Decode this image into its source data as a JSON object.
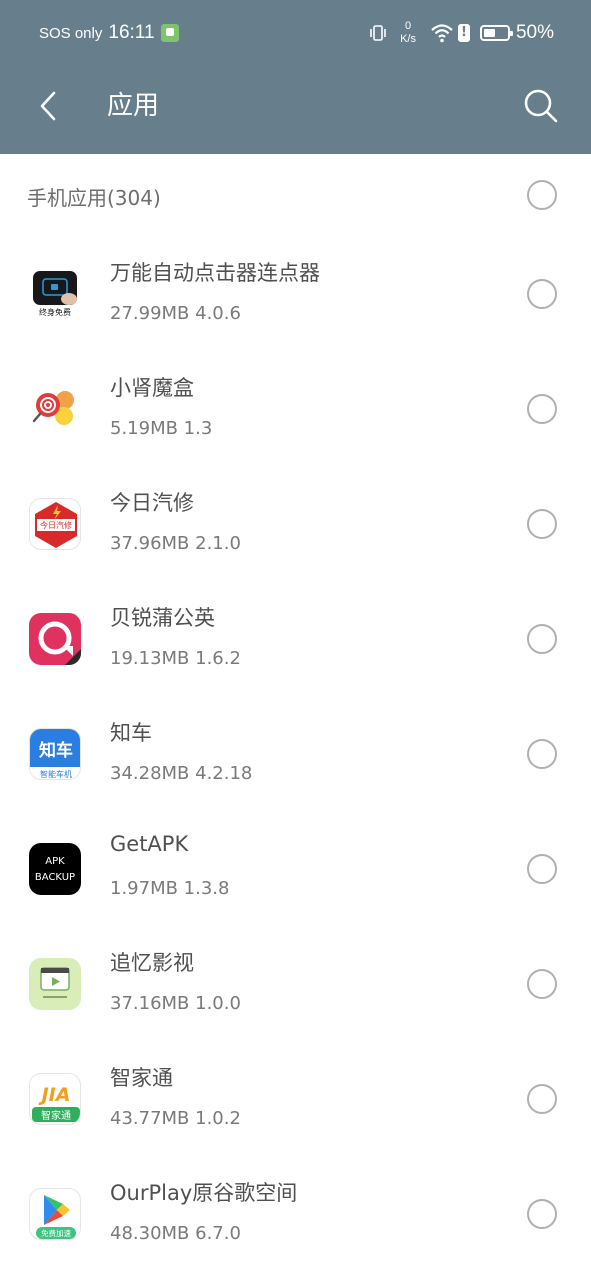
{
  "status_bar": {
    "carrier": "SOS only",
    "time": "16:11",
    "net_speed_value": "0",
    "net_speed_unit": "K/s",
    "battery_percent_label": "50%",
    "battery_level": 0.5
  },
  "app_bar": {
    "title": "应用",
    "back_icon": "chevron-left-icon",
    "search_icon": "search-icon"
  },
  "section": {
    "label": "手机应用(304)"
  },
  "apps": [
    {
      "name": "万能自动点击器连点器",
      "meta": "27.99MB 4.0.6",
      "icon_text": "终身免费"
    },
    {
      "name": "小肾魔盒",
      "meta": "5.19MB 1.3",
      "icon_text": ""
    },
    {
      "name": "今日汽修",
      "meta": "37.96MB 2.1.0",
      "icon_text": "今日汽修"
    },
    {
      "name": "贝锐蒲公英",
      "meta": "19.13MB 1.6.2",
      "icon_text": ""
    },
    {
      "name": "知车",
      "meta": "34.28MB 4.2.18",
      "icon_text": "知车",
      "icon_subtext": "智能车机"
    },
    {
      "name": "GetAPK",
      "meta": "1.97MB 1.3.8",
      "icon_text": "APK",
      "icon_subtext": "BACKUP"
    },
    {
      "name": "追忆影视",
      "meta": "37.16MB 1.0.0",
      "icon_text": ""
    },
    {
      "name": "智家通",
      "meta": "43.77MB 1.0.2",
      "icon_text": "JIA",
      "icon_subtext": "智家通"
    },
    {
      "name": "OurPlay原谷歌空间",
      "meta": "48.30MB 6.7.0",
      "icon_text": "免费加速"
    }
  ],
  "colors": {
    "header_bg": "#677f8d",
    "radio_border": "#b0b0b0",
    "primary_text": "#505050",
    "secondary_text": "#7a7a7a"
  }
}
